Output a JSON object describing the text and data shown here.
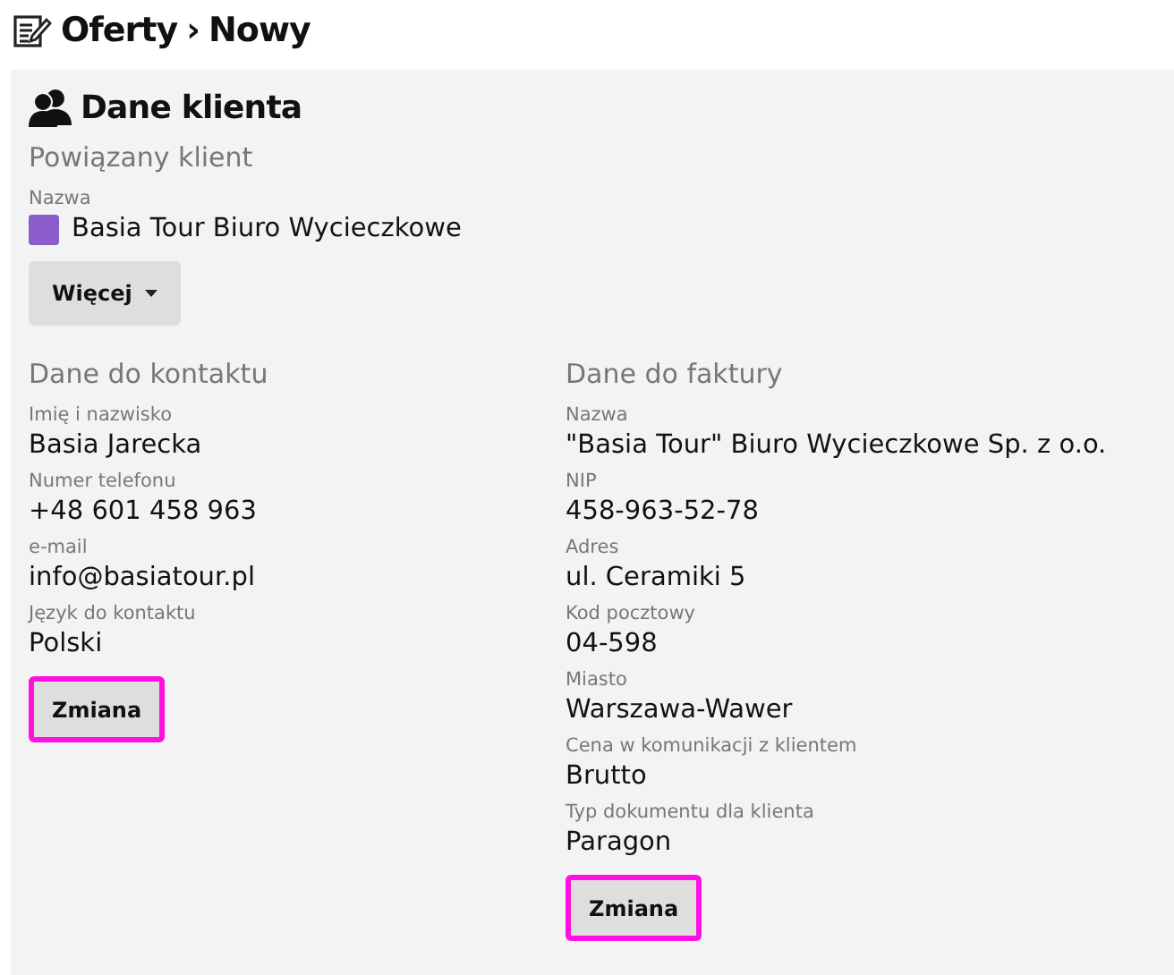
{
  "breadcrumb": {
    "section": "Oferty",
    "separator": "›",
    "current": "Nowy"
  },
  "client_panel": {
    "title": "Dane klienta",
    "linked_heading": "Powiązany klient",
    "name_label": "Nazwa",
    "name": "Basia Tour Biuro Wycieczkowe",
    "color": "#8a5ccc",
    "more_button": "Więcej"
  },
  "contact": {
    "heading": "Dane do kontaktu",
    "fields": [
      {
        "label": "Imię i nazwisko",
        "value": "Basia Jarecka"
      },
      {
        "label": "Numer telefonu",
        "value": "+48 601 458 963"
      },
      {
        "label": "e-mail",
        "value": "info@basiatour.pl"
      },
      {
        "label": "Język do kontaktu",
        "value": "Polski"
      }
    ],
    "button": {
      "label": "Zmiana",
      "highlighted": true
    }
  },
  "invoice": {
    "heading": "Dane do faktury",
    "fields": [
      {
        "label": "Nazwa",
        "value": "\"Basia Tour\" Biuro Wycieczkowe Sp. z o.o."
      },
      {
        "label": "NIP",
        "value": "458-963-52-78"
      },
      {
        "label": "Adres",
        "value": "ul. Ceramiki 5"
      },
      {
        "label": "Kod pocztowy",
        "value": "04-598"
      },
      {
        "label": "Miasto",
        "value": "Warszawa-Wawer"
      },
      {
        "label": "Cena w komunikacji z klientem",
        "value": "Brutto"
      },
      {
        "label": "Typ dokumentu dla klienta",
        "value": "Paragon"
      }
    ],
    "button": {
      "label": "Zmiana",
      "highlighted": true
    }
  }
}
